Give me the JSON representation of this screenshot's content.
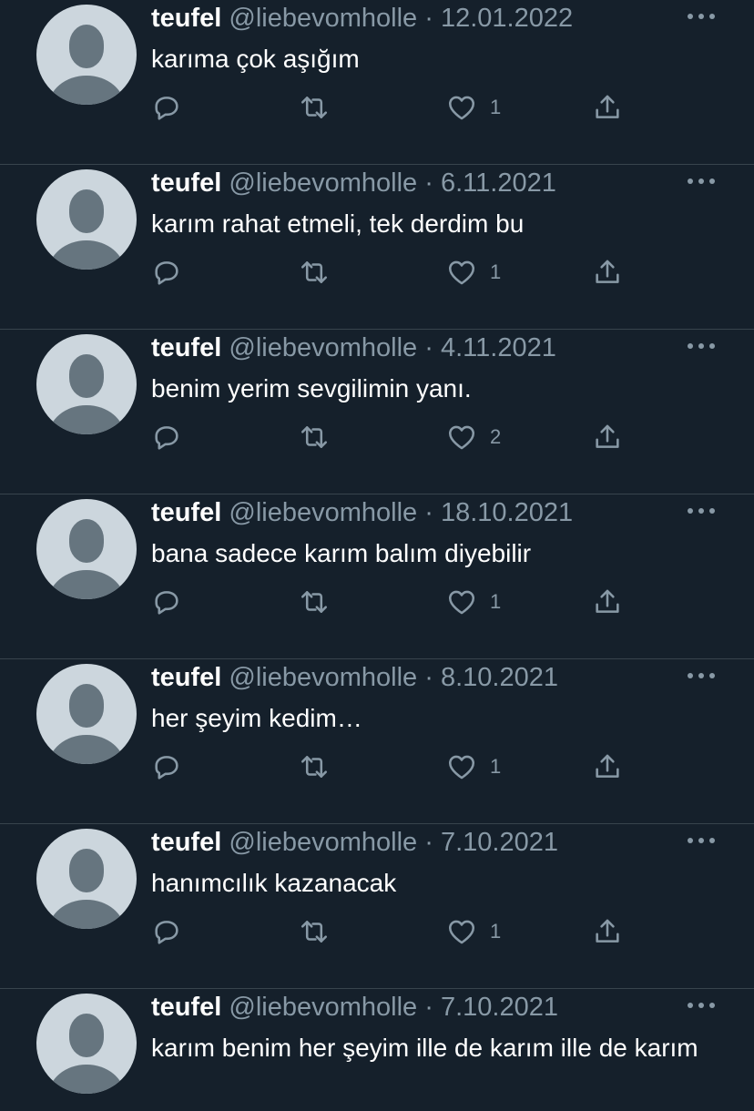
{
  "tweets": [
    {
      "name": "teufel",
      "handle": "@liebevomholle",
      "sep": " · ",
      "date": "12.01.2022",
      "text": "karıma çok aşığım",
      "likes": "1"
    },
    {
      "name": "teufel",
      "handle": "@liebevomholle",
      "sep": " · ",
      "date": "6.11.2021",
      "text": "karım rahat etmeli, tek derdim bu",
      "likes": "1"
    },
    {
      "name": "teufel",
      "handle": "@liebevomholle",
      "sep": " · ",
      "date": "4.11.2021",
      "text": "benim yerim sevgilimin yanı.",
      "likes": "2"
    },
    {
      "name": "teufel",
      "handle": "@liebevomholle",
      "sep": " · ",
      "date": "18.10.2021",
      "text": "bana sadece karım balım diyebilir",
      "likes": "1"
    },
    {
      "name": "teufel",
      "handle": "@liebevomholle",
      "sep": " · ",
      "date": "8.10.2021",
      "text": "her şeyim kedim…",
      "likes": "1"
    },
    {
      "name": "teufel",
      "handle": "@liebevomholle",
      "sep": " · ",
      "date": "7.10.2021",
      "text": "hanımcılık kazanacak",
      "likes": "1"
    },
    {
      "name": "teufel",
      "handle": "@liebevomholle",
      "sep": " · ",
      "date": "7.10.2021",
      "text": "karım benim her şeyim ille de karım ille de karım",
      "likes": ""
    }
  ],
  "icons": {
    "reply": "reply-icon",
    "retweet": "retweet-icon",
    "like": "heart-icon",
    "share": "share-icon",
    "more": "more-icon"
  },
  "colors": {
    "background": "#15202b",
    "secondary_text": "#8899a6",
    "divider": "#38444d",
    "avatar_bg": "#ccd6dd",
    "avatar_fg": "#66757f"
  }
}
